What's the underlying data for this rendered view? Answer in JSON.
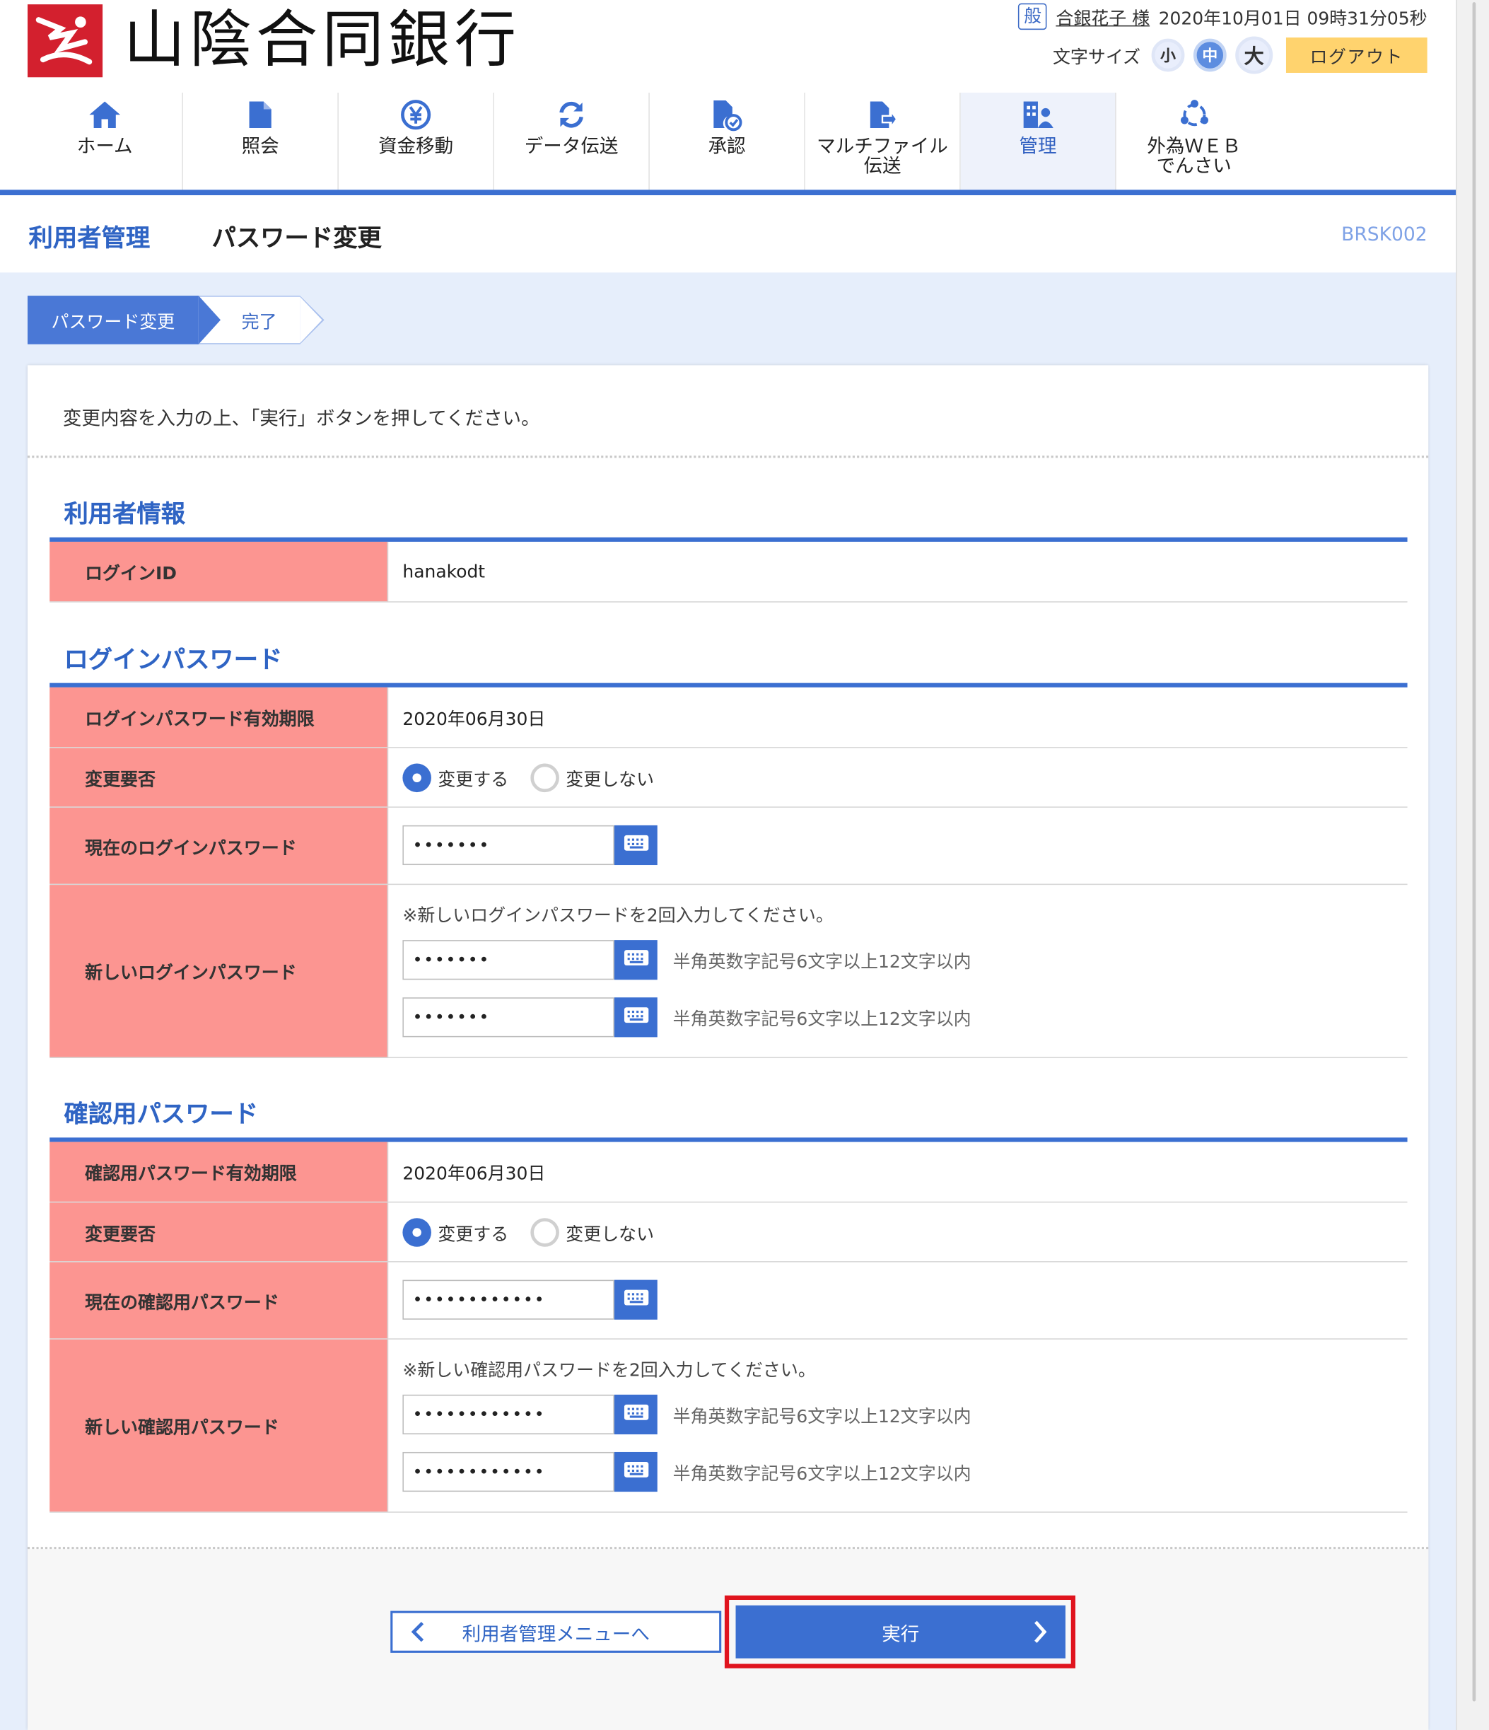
{
  "header": {
    "bank_name": "山陰合同銀行",
    "user_badge": "般",
    "user_name": "合銀花子 様",
    "datetime": "2020年10月01日 09時31分05秒",
    "font_size_label": "文字サイズ",
    "font_sizes": [
      "小",
      "中",
      "大"
    ],
    "logout_label": "ログアウト"
  },
  "nav": [
    {
      "label": "ホーム",
      "icon": "home-icon"
    },
    {
      "label": "照会",
      "icon": "document-icon"
    },
    {
      "label": "資金移動",
      "icon": "yen-icon"
    },
    {
      "label": "データ伝送",
      "icon": "sync-icon"
    },
    {
      "label": "承認",
      "icon": "approve-icon"
    },
    {
      "label": "マルチファイル\n伝送",
      "icon": "file-transfer-icon"
    },
    {
      "label": "管理",
      "icon": "admin-icon"
    },
    {
      "label": "外為ＷＥＢ\nでんさい",
      "icon": "network-icon"
    }
  ],
  "page": {
    "section_title": "利用者管理",
    "page_title": "パスワード変更",
    "screen_code": "BRSK002"
  },
  "steps": [
    "パスワード変更",
    "完了"
  ],
  "intro": "変更内容を入力の上、「実行」ボタンを押してください。",
  "user_info": {
    "heading": "利用者情報",
    "login_id_label": "ログインID",
    "login_id_value": "hanakodt"
  },
  "login_password": {
    "heading": "ログインパスワード",
    "expiry_label": "ログインパスワード有効期限",
    "expiry_value": "2020年06月30日",
    "change_label": "変更要否",
    "option_change": "変更する",
    "option_nochange": "変更しない",
    "current_label": "現在のログインパスワード",
    "current_value": "•••••••",
    "new_label": "新しいログインパスワード",
    "new_note": "※新しいログインパスワードを2回入力してください。",
    "new_value1": "•••••••",
    "new_value2": "•••••••",
    "hint": "半角英数字記号6文字以上12文字以内"
  },
  "confirm_password": {
    "heading": "確認用パスワード",
    "expiry_label": "確認用パスワード有効期限",
    "expiry_value": "2020年06月30日",
    "change_label": "変更要否",
    "option_change": "変更する",
    "option_nochange": "変更しない",
    "current_label": "現在の確認用パスワード",
    "current_value": "••••••••••••",
    "new_label": "新しい確認用パスワード",
    "new_note": "※新しい確認用パスワードを2回入力してください。",
    "new_value1": "••••••••••••",
    "new_value2": "••••••••••••",
    "hint": "半角英数字記号6文字以上12文字以内"
  },
  "buttons": {
    "back": "利用者管理メニューへ",
    "execute": "実行"
  },
  "colors": {
    "accent": "#3b6fd1",
    "label_bg": "#fc9591",
    "highlight": "#e0141e",
    "logout": "#ffd36e"
  }
}
